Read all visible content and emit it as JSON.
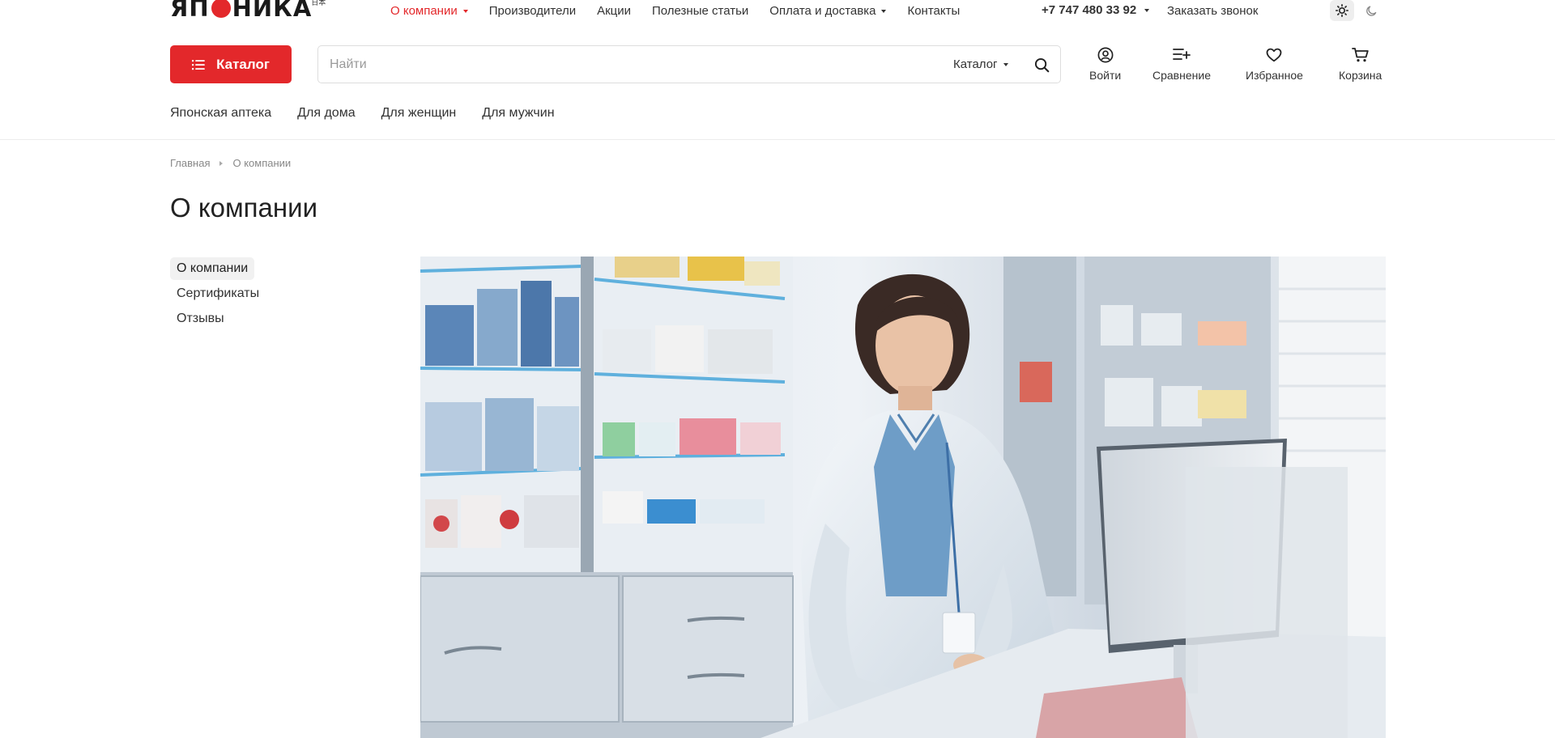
{
  "brand": {
    "logo_left": "ЯП",
    "logo_right": "НИКА",
    "logo_small": "日本",
    "accent_color": "#e3282b"
  },
  "topnav": {
    "items": [
      {
        "label": "О компании",
        "has_dropdown": true,
        "active": true
      },
      {
        "label": "Производители",
        "has_dropdown": false
      },
      {
        "label": "Акции",
        "has_dropdown": false
      },
      {
        "label": "Полезные статьи",
        "has_dropdown": false
      },
      {
        "label": "Оплата и доставка",
        "has_dropdown": true
      },
      {
        "label": "Контакты",
        "has_dropdown": false
      }
    ],
    "phone": "+7 747 480 33 92",
    "callback_label": "Заказать звонок",
    "theme": {
      "light_icon": "sun-icon",
      "dark_icon": "moon-icon",
      "selected": "light"
    }
  },
  "header": {
    "catalog_label": "Каталог",
    "search": {
      "placeholder": "Найти",
      "value": "",
      "scope_label": "Каталог"
    },
    "actions": [
      {
        "label": "Войти",
        "icon": "user-icon"
      },
      {
        "label": "Сравнение",
        "icon": "compare-icon"
      },
      {
        "label": "Избранное",
        "icon": "heart-icon"
      },
      {
        "label": "Корзина",
        "icon": "cart-icon"
      }
    ]
  },
  "categories": [
    "Японская аптека",
    "Для дома",
    "Для женщин",
    "Для мужчин"
  ],
  "breadcrumb": [
    "Главная",
    "О компании"
  ],
  "page": {
    "title": "О компании"
  },
  "sidemenu": {
    "items": [
      {
        "label": "О компании",
        "active": true
      },
      {
        "label": "Сертификаты",
        "active": false
      },
      {
        "label": "Отзывы",
        "active": false
      }
    ]
  }
}
